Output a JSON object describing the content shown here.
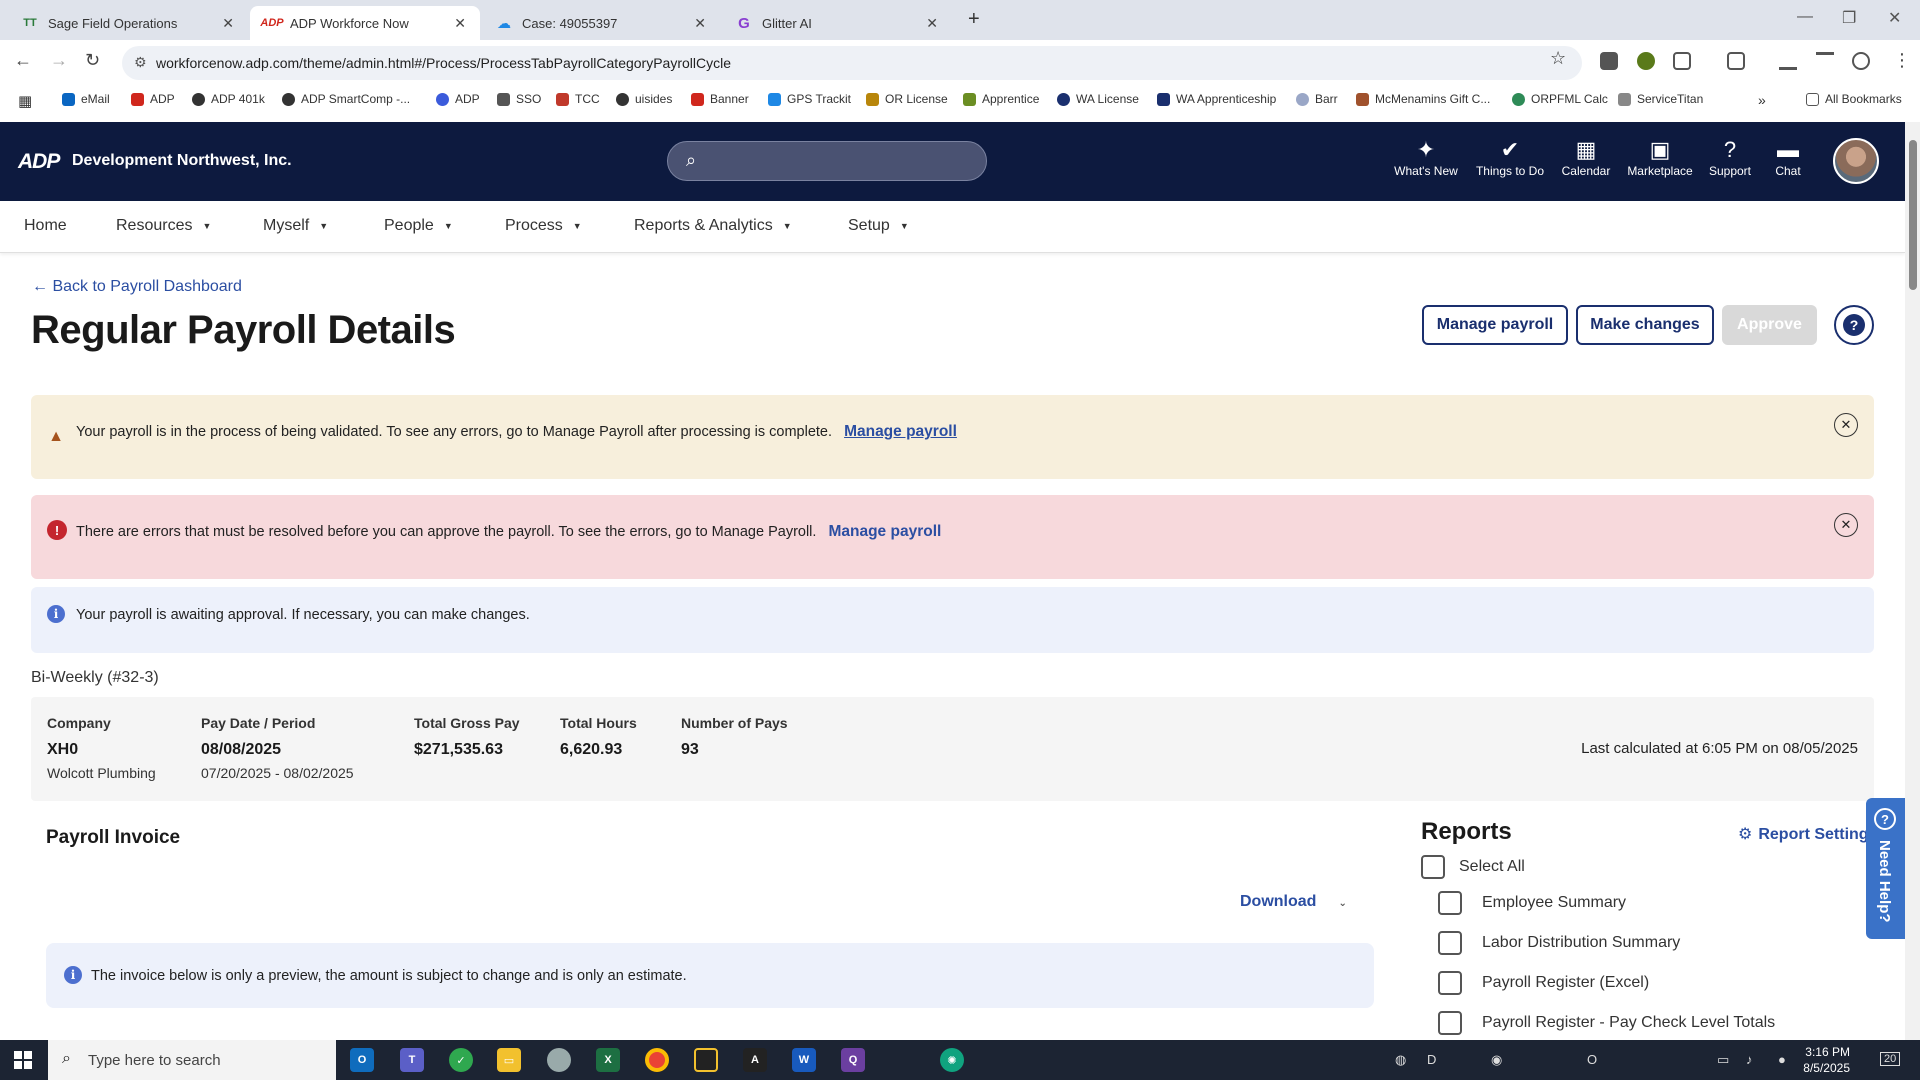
{
  "browser": {
    "tabs": [
      {
        "label": "Sage Field Operations",
        "favicon": "TT"
      },
      {
        "label": "ADP Workforce Now",
        "favicon": "ADP"
      },
      {
        "label": "Case: 49055397",
        "favicon": "cloud"
      },
      {
        "label": "Glitter AI",
        "favicon": "G"
      }
    ],
    "url": "workforcenow.adp.com/theme/admin.html#/Process/ProcessTabPayrollCategoryPayrollCycle",
    "bookmarks": [
      "eMail",
      "ADP",
      "ADP 401k",
      "ADP SmartComp -...",
      "ADP",
      "SSO",
      "TCC",
      "uisides",
      "Banner",
      "GPS Trackit",
      "OR License",
      "Apprentice",
      "WA License",
      "WA Apprenticeship",
      "Barr",
      "McMenamins Gift C...",
      "ORPFML Calc",
      "ServiceTitan"
    ],
    "all_bookmarks": "All Bookmarks"
  },
  "header": {
    "logo": "ADP",
    "company": "Development Northwest, Inc.",
    "items": [
      "What's New",
      "Things to Do",
      "Calendar",
      "Marketplace",
      "Support",
      "Chat"
    ]
  },
  "nav": [
    "Home",
    "Resources",
    "Myself",
    "People",
    "Process",
    "Reports & Analytics",
    "Setup"
  ],
  "page": {
    "back_link": "Back to Payroll Dashboard",
    "title": "Regular Payroll Details",
    "buttons": {
      "manage": "Manage payroll",
      "changes": "Make changes",
      "approve": "Approve"
    }
  },
  "alerts": {
    "warning": {
      "text": "Your payroll is in the process of being validated. To see any errors, go to Manage Payroll after processing is complete.",
      "link": "Manage payroll"
    },
    "error": {
      "text": "There are errors that must be resolved before you can approve the payroll. To see the errors, go to Manage Payroll.",
      "link": "Manage payroll"
    },
    "info": {
      "text": "Your payroll is awaiting approval. If necessary, you can make changes."
    }
  },
  "summary": {
    "period_label": "Bi-Weekly (#32-3)",
    "company_label": "Company",
    "company_code": "XH0",
    "company_name": "Wolcott Plumbing",
    "paydate_label": "Pay Date / Period",
    "pay_date": "08/08/2025",
    "pay_period": "07/20/2025 - 08/02/2025",
    "gross_label": "Total Gross Pay",
    "gross": "$271,535.63",
    "hours_label": "Total Hours",
    "hours": "6,620.93",
    "pays_label": "Number of Pays",
    "pays": "93",
    "last_calculated": "Last calculated at 6:05 PM on 08/05/2025"
  },
  "invoice": {
    "title": "Payroll Invoice",
    "download": "Download",
    "note": "The invoice below is only a preview, the amount is subject to change and is only an estimate."
  },
  "reports": {
    "title": "Reports",
    "settings": "Report Setting",
    "select_all": "Select All",
    "items": [
      "Employee Summary",
      "Labor Distribution Summary",
      "Payroll Register (Excel)",
      "Payroll Register - Pay Check Level Totals"
    ]
  },
  "need_help": "Need Help?",
  "taskbar": {
    "search_placeholder": "Type here to search",
    "time": "3:16 PM",
    "date": "8/5/2025",
    "notifications": "20"
  },
  "colors": {
    "adp_navy": "#0d1a3f",
    "link_blue": "#2b4ea2",
    "warning_bg": "#f7efdc",
    "error_bg": "#f7d9dc",
    "info_bg": "#edf1fb"
  }
}
